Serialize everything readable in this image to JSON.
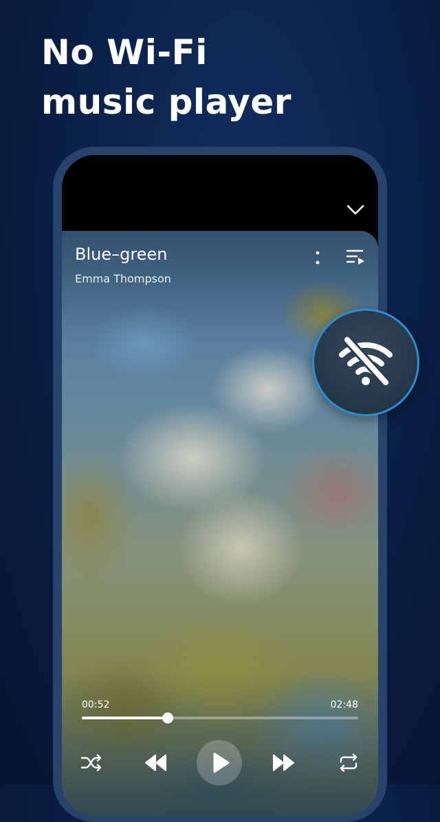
{
  "promo": {
    "headline_line1": "No Wi-Fi",
    "headline_line2": "music player"
  },
  "player": {
    "song_title": "Blue–green",
    "artist": "Emma Thompson",
    "elapsed": "00:52",
    "duration": "02:48",
    "progress": 0.31
  },
  "icons": {
    "collapse": "chevron-down-icon",
    "more": "more-vertical-icon",
    "queue": "queue-playlist-icon",
    "shuffle": "shuffle-icon",
    "previous": "rewind-icon",
    "play": "play-icon",
    "next": "fast-forward-icon",
    "repeat": "repeat-icon",
    "badge": "wifi-off-icon"
  },
  "colors": {
    "background": "#0a1f46",
    "phone_frame": "#27426b",
    "badge_border": "#2b8ed0",
    "text": "#ffffff"
  }
}
